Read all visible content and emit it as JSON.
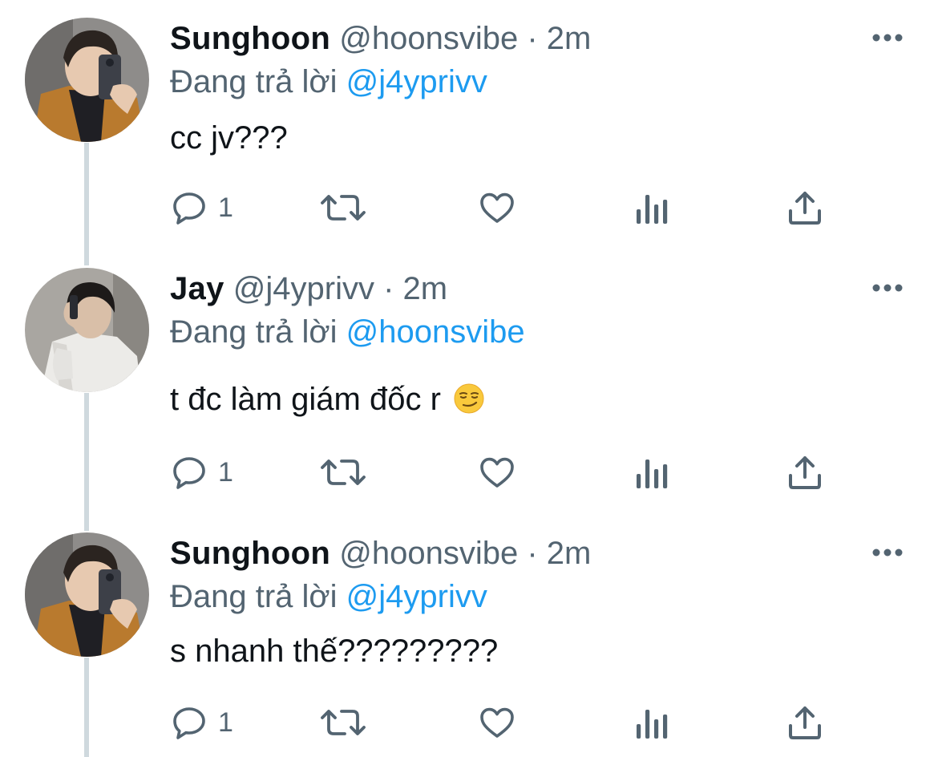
{
  "colors": {
    "text": "#0f1419",
    "muted": "#536471",
    "link": "#1d9bf0",
    "thread_line": "#cfd9de"
  },
  "replying_label": "Đang trả lời",
  "tweets": [
    {
      "name": "Sunghoon",
      "handle": "@hoonsvibe",
      "separator": "·",
      "time": "2m",
      "reply_to": "@j4yprivv",
      "text": "cc jv???",
      "emoji": "",
      "reply_count": "1",
      "avatar": "avatar-selfie-mirror"
    },
    {
      "name": "Jay",
      "handle": "@j4yprivv",
      "separator": "·",
      "time": "2m",
      "reply_to": "@hoonsvibe",
      "text": "t đc làm giám đốc r",
      "emoji": "smirking-face",
      "reply_count": "1",
      "avatar": "avatar-phone-call"
    },
    {
      "name": "Sunghoon",
      "handle": "@hoonsvibe",
      "separator": "·",
      "time": "2m",
      "reply_to": "@j4yprivv",
      "text": "s nhanh thế?????????",
      "emoji": "",
      "reply_count": "1",
      "avatar": "avatar-selfie-mirror"
    }
  ],
  "icons": {
    "reply": "reply-icon",
    "retweet": "retweet-icon",
    "like": "like-icon",
    "analytics": "analytics-icon",
    "share": "share-icon",
    "more": "more-icon"
  }
}
